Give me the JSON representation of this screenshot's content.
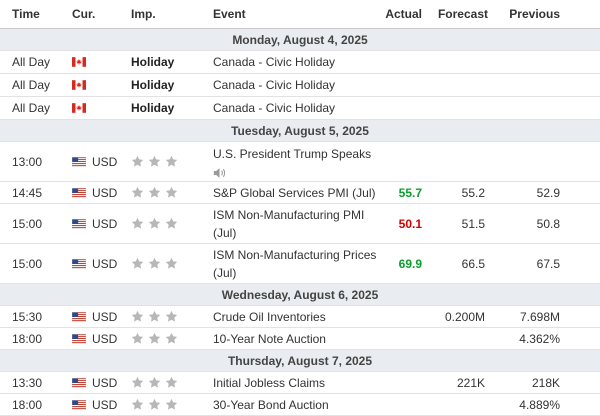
{
  "header": {
    "time": "Time",
    "cur": "Cur.",
    "imp": "Imp.",
    "event": "Event",
    "actual": "Actual",
    "forecast": "Forecast",
    "previous": "Previous"
  },
  "days": [
    {
      "label": "Monday, August 4, 2025"
    },
    {
      "label": "Tuesday, August 5, 2025"
    },
    {
      "label": "Wednesday, August 6, 2025"
    },
    {
      "label": "Thursday, August 7, 2025"
    }
  ],
  "events": [
    {
      "time": "All Day",
      "currency": "",
      "flag": "canada-flag-icon",
      "importance": "Holiday",
      "event": "Canada - Civic Holiday",
      "actual": "",
      "forecast": "",
      "previous": ""
    },
    {
      "time": "All Day",
      "currency": "",
      "flag": "canada-flag-icon",
      "importance": "Holiday",
      "event": "Canada - Civic Holiday",
      "actual": "",
      "forecast": "",
      "previous": ""
    },
    {
      "time": "All Day",
      "currency": "",
      "flag": "canada-flag-icon",
      "importance": "Holiday",
      "event": "Canada - Civic Holiday",
      "actual": "",
      "forecast": "",
      "previous": ""
    },
    {
      "time": "13:00",
      "currency": "USD",
      "flag": "us-flag-icon",
      "stars": 3,
      "event": "U.S. President Trump Speaks",
      "speaker_icon": "speaker-icon",
      "actual": "",
      "forecast": "",
      "previous": ""
    },
    {
      "time": "14:45",
      "currency": "USD",
      "flag": "us-flag-icon",
      "stars": 3,
      "event": "S&P Global Services PMI (Jul)",
      "actual": "55.7",
      "actual_color": "#0b9d2c",
      "forecast": "55.2",
      "previous": "52.9"
    },
    {
      "time": "15:00",
      "currency": "USD",
      "flag": "us-flag-icon",
      "stars": 3,
      "event": "ISM Non-Manufacturing PMI (Jul)",
      "actual": "50.1",
      "actual_color": "#d10000",
      "forecast": "51.5",
      "previous": "50.8"
    },
    {
      "time": "15:00",
      "currency": "USD",
      "flag": "us-flag-icon",
      "stars": 3,
      "event": "ISM Non-Manufacturing Prices (Jul)",
      "actual": "69.9",
      "actual_color": "#0b9d2c",
      "forecast": "66.5",
      "previous": "67.5"
    },
    {
      "time": "15:30",
      "currency": "USD",
      "flag": "us-flag-icon",
      "stars": 3,
      "event": "Crude Oil Inventories",
      "actual": "",
      "forecast": "0.200M",
      "previous": "7.698M"
    },
    {
      "time": "18:00",
      "currency": "USD",
      "flag": "us-flag-icon",
      "stars": 3,
      "event": "10-Year Note Auction",
      "actual": "",
      "forecast": "",
      "previous": "4.362%"
    },
    {
      "time": "13:30",
      "currency": "USD",
      "flag": "us-flag-icon",
      "stars": 3,
      "event": "Initial Jobless Claims",
      "actual": "",
      "forecast": "221K",
      "previous": "218K"
    },
    {
      "time": "18:00",
      "currency": "USD",
      "flag": "us-flag-icon",
      "stars": 3,
      "event": "30-Year Bond Auction",
      "actual": "",
      "forecast": "",
      "previous": "4.889%"
    }
  ],
  "colors": {
    "day_bg": "#e9ecf0",
    "star": "#b7b7b7",
    "positive": "#0b9d2c",
    "negative": "#d10000"
  }
}
